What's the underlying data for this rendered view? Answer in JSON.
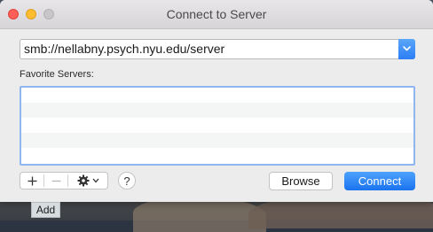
{
  "window": {
    "title": "Connect to Server"
  },
  "server_address": {
    "value": "smb://nellabny.psych.nyu.edu/server"
  },
  "favorites": {
    "label": "Favorite Servers:",
    "items": []
  },
  "toolbar": {
    "add_icon": "plus-icon",
    "remove_icon": "minus-icon",
    "action_icon": "gear-icon",
    "help_label": "?"
  },
  "buttons": {
    "browse_label": "Browse",
    "connect_label": "Connect"
  },
  "tooltip": {
    "text": "Add"
  },
  "colors": {
    "accent": "#2c7ef5",
    "close": "#ff5f57",
    "minimize": "#febc2e",
    "selection_border": "#8fb6ef"
  }
}
